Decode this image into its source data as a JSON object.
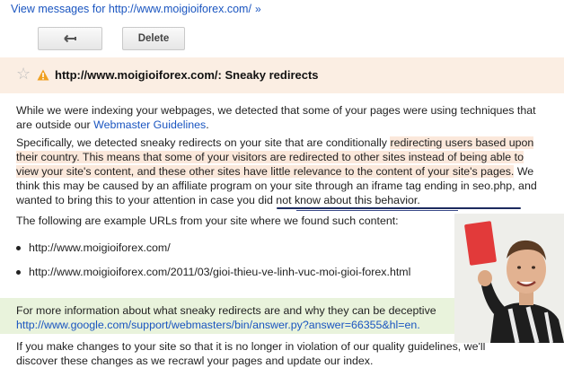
{
  "top_link": {
    "text": "View messages for http://www.moigioiforex.com/",
    "chevron": "»"
  },
  "toolbar": {
    "back_icon": "back-arrow-icon",
    "delete_label": "Delete"
  },
  "message": {
    "star_icon": "star-icon",
    "warning_icon": "warning-icon",
    "title": "http://www.moigioiforex.com/: Sneaky redirects",
    "intro_part1": "While we were indexing your webpages, we detected that some of your pages were using techniques that are outside our ",
    "guidelines_link": "Webmaster Guidelines",
    "intro_part2": ".",
    "detail_part1": "Specifically, we detected sneaky redirects on your site that are conditionally ",
    "detail_highlight": "redirecting users based upon their country. This means that some of your visitors are redirected to other sites instead of being able to view your site's content, and these other sites have little relevance to the content of your site's pages.",
    "detail_part2": " We think this may be caused by an affiliate program on your site through an iframe tag ending in seo.php, and wanted to bring this to your attention ",
    "detail_underlined": "in case you did not know about this behavior.",
    "examples_intro": "The following are example URLs from your site where we found such content:",
    "urls": [
      "http://www.moigioiforex.com/",
      "http://www.moigioiforex.com/2011/03/gioi-thieu-ve-linh-vuc-moi-gioi-forex.html"
    ],
    "info_text": "For more information about what sneaky redirects are and why they can be deceptive",
    "info_link": "http://www.google.com/support/webmasters/bin/answer.py?answer=66355&hl=en.",
    "closing": "If you make changes to your site so that it is no longer in violation of our quality guidelines, we'll discover these changes as we recrawl your pages and update our index."
  },
  "colors": {
    "link": "#1a55c0",
    "header_bg": "#fbeee3",
    "highlight": "#fbe8db",
    "info_bg": "#e9f3dc",
    "warning": "#f0a020"
  }
}
